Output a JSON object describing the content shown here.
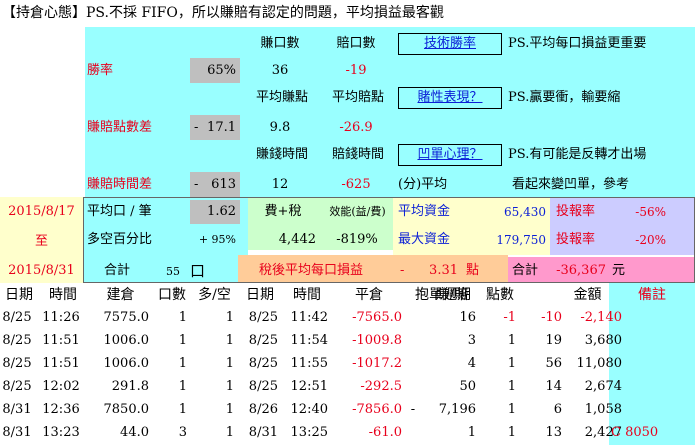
{
  "title": "【持倉心態】PS.不採 FIFO，所以賺賠有認定的問題，平均損益最客觀",
  "stats": {
    "h_win_count": "賺口數",
    "h_lose_count": "賠口數",
    "btn_technical": "技術勝率",
    "note1": "PS.平均每口損益更重要",
    "win_rate_label": "勝率",
    "win_rate_value": "65%",
    "win_count": "36",
    "lose_count": "-19",
    "h_avg_win_pts": "平均賺點",
    "h_avg_lose_pts": "平均賠點",
    "btn_gambling": "賭性表現？",
    "note2": "PS.贏要衝，輸要縮",
    "pt_diff_label": "賺賠點數差",
    "pt_diff_sign": "-",
    "pt_diff_value": "17.1",
    "avg_win_pts": "9.8",
    "avg_lose_pts": "-26.9",
    "h_win_time": "賺錢時間",
    "h_lose_time": "賠錢時間",
    "btn_bag": "凹單心理？",
    "note3": "PS.有可能是反轉才出場",
    "time_diff_label": "賺賠時間差",
    "time_diff_sign": "-",
    "time_diff_value": "613",
    "win_time": "12",
    "lose_time": "-625",
    "time_unit": "(分)平均",
    "note4": "看起來變凹單，參考"
  },
  "summary": {
    "date_start": "2015/8/17",
    "date_to": "至",
    "date_end": "2015/8/31",
    "avg_lot_label": "平均口 / 筆",
    "avg_lot_value": "1.62",
    "fee_label": "費+稅",
    "eff_label": "效能(益/費)",
    "avg_fund_label": "平均資金",
    "avg_fund_value": "65,430",
    "roi_label1": "投報率",
    "roi_value1": "-56%",
    "ls_label": "多空百分比",
    "ls_value": "+ 95%",
    "fee_value": "4,442",
    "eff_value": "-819%",
    "max_fund_label": "最大資金",
    "max_fund_value": "179,750",
    "roi_label2": "投報率",
    "roi_value2": "-20%",
    "total_label": "合計",
    "total_lots": "55",
    "lot_unit": "口",
    "after_tax_label": "稅後平均每口損益",
    "after_tax_sign": "-",
    "after_tax_value": "3.31",
    "after_tax_unit": "點",
    "sum_label": "合計",
    "sum_value": "-36,367",
    "sum_unit": "元"
  },
  "table": {
    "headers": [
      "日期",
      "時間",
      "建倉",
      "口數",
      "多/空",
      "日期",
      "時間",
      "平倉",
      "抱單週期",
      "賺/賠",
      "點數",
      "金額",
      "備註"
    ],
    "rows": [
      [
        "8/25",
        "11:26",
        "7575.0",
        "1",
        "1",
        "8/25",
        "11:42",
        "-7565.0",
        "",
        "16",
        "-1",
        "-10",
        "-2,140",
        ""
      ],
      [
        "8/25",
        "11:51",
        "1006.0",
        "1",
        "1",
        "8/25",
        "11:54",
        "-1009.8",
        "",
        "3",
        "1",
        "19",
        "3,680",
        ""
      ],
      [
        "8/25",
        "11:51",
        "1006.0",
        "1",
        "1",
        "8/25",
        "11:55",
        "-1017.2",
        "",
        "4",
        "1",
        "56",
        "11,080",
        ""
      ],
      [
        "8/25",
        "12:02",
        "291.8",
        "1",
        "1",
        "8/25",
        "12:51",
        "-292.5",
        "",
        "50",
        "1",
        "14",
        "2,674",
        ""
      ],
      [
        "8/31",
        "12:36",
        "7850.0",
        "1",
        "1",
        "8/26",
        "12:40",
        "-7856.0",
        "-",
        "7,196",
        "1",
        "6",
        "1,058",
        ""
      ],
      [
        "8/31",
        "13:23",
        "44.0",
        "3",
        "1",
        "8/31",
        "13:25",
        "-61.0",
        "",
        "1",
        "1",
        "13",
        "2,427",
        "C 8050"
      ]
    ]
  }
}
